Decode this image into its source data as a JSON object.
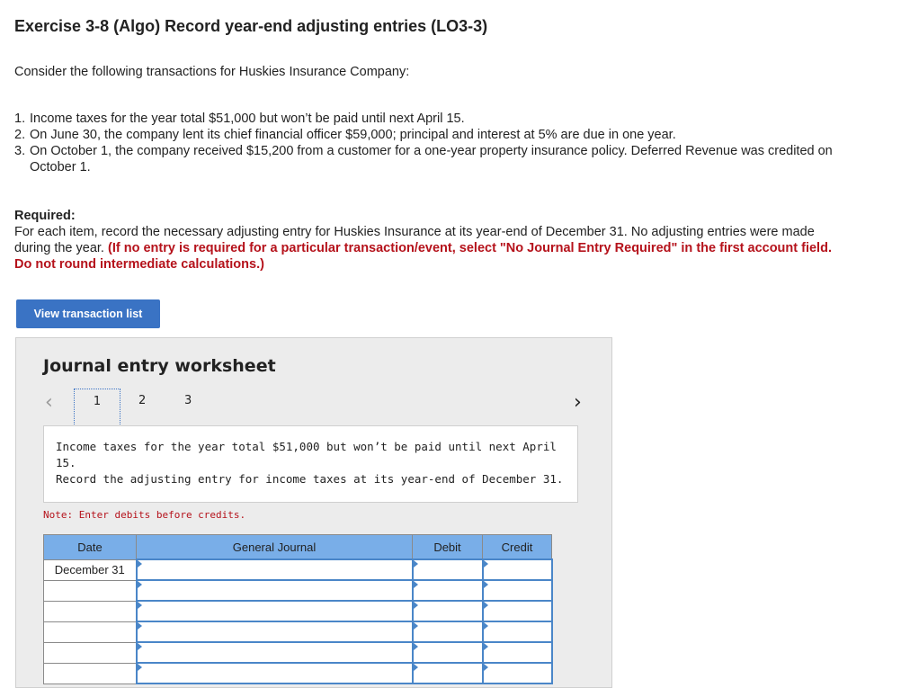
{
  "header": {
    "title": "Exercise 3-8 (Algo) Record year-end adjusting entries (LO3-3)"
  },
  "intro": "Consider the following transactions for Huskies Insurance Company:",
  "transactions": [
    {
      "num": "1.",
      "text": "Income taxes for the year total $51,000 but won’t be paid until next April 15."
    },
    {
      "num": "2.",
      "text": "On June 30, the company lent its chief financial officer $59,000; principal and interest at 5% are due in one year."
    },
    {
      "num": "3.",
      "text": "On October 1, the company received $15,200 from a customer for a one-year property insurance policy. Deferred Revenue was credited on October 1."
    }
  ],
  "required": {
    "label": "Required:",
    "text": "For each item, record the necessary adjusting entry for Huskies Insurance at its year-end of December 31. No adjusting entries were made during the year.",
    "instruction": "(If no entry is required for a particular transaction/event, select \"No Journal Entry Required\" in the first account field. Do not round intermediate calculations.)"
  },
  "buttons": {
    "view_transactions": "View transaction list"
  },
  "worksheet": {
    "title": "Journal entry worksheet",
    "pages": [
      "1",
      "2",
      "3"
    ],
    "description_line1": "Income taxes for the year total $51,000 but won’t be paid until next April 15.",
    "description_line2": "Record the adjusting entry for income taxes at its year-end of December 31.",
    "note": "Note: Enter debits before credits.",
    "columns": {
      "date": "Date",
      "journal": "General Journal",
      "debit": "Debit",
      "credit": "Credit"
    },
    "first_date": "December 31"
  }
}
